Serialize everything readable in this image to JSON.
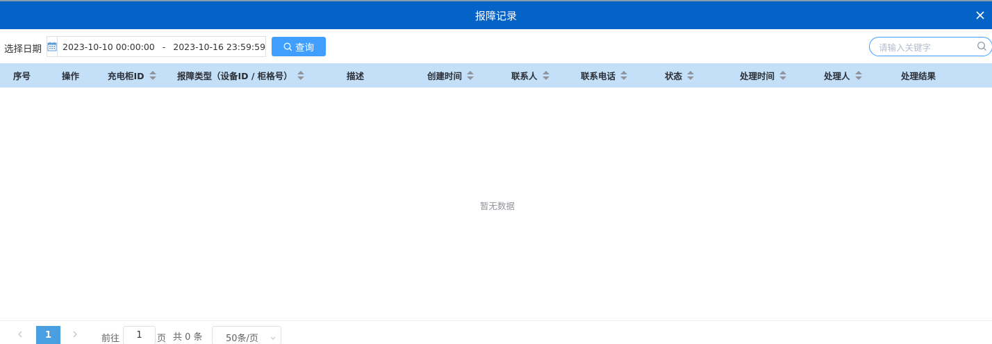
{
  "dialog": {
    "title": "报障记录",
    "close_icon": "close-icon"
  },
  "toolbar": {
    "date_label": "选择日期",
    "calendar_icon": "calendar-icon",
    "date_start": "2023-10-10 00:00:00",
    "date_separator": "-",
    "date_end": "2023-10-16 23:59:59",
    "query_label": "查询",
    "search_placeholder": "请输入关键字",
    "search_value": ""
  },
  "table": {
    "columns": [
      {
        "label": "序号",
        "sortable": false
      },
      {
        "label": "操作",
        "sortable": false
      },
      {
        "label": "充电柜ID",
        "sortable": true
      },
      {
        "label": "报障类型（设备ID / 柜格号）",
        "sortable": true
      },
      {
        "label": "描述",
        "sortable": false
      },
      {
        "label": "创建时间",
        "sortable": true
      },
      {
        "label": "联系人",
        "sortable": true
      },
      {
        "label": "联系电话",
        "sortable": true
      },
      {
        "label": "状态",
        "sortable": true
      },
      {
        "label": "处理时间",
        "sortable": true
      },
      {
        "label": "处理人",
        "sortable": true
      },
      {
        "label": "处理结果",
        "sortable": false
      }
    ],
    "rows": [],
    "empty_text": "暂无数据"
  },
  "pagination": {
    "current_page": "1",
    "goto_label": "前往",
    "goto_value": "1",
    "page_label": "页",
    "total_text": "共 0 条",
    "page_size": "50条/页"
  },
  "colors": {
    "title_bar": "#0563c8",
    "primary": "#409eff",
    "header_bg": "#c4dff8",
    "active_page": "#4a9fe0"
  }
}
